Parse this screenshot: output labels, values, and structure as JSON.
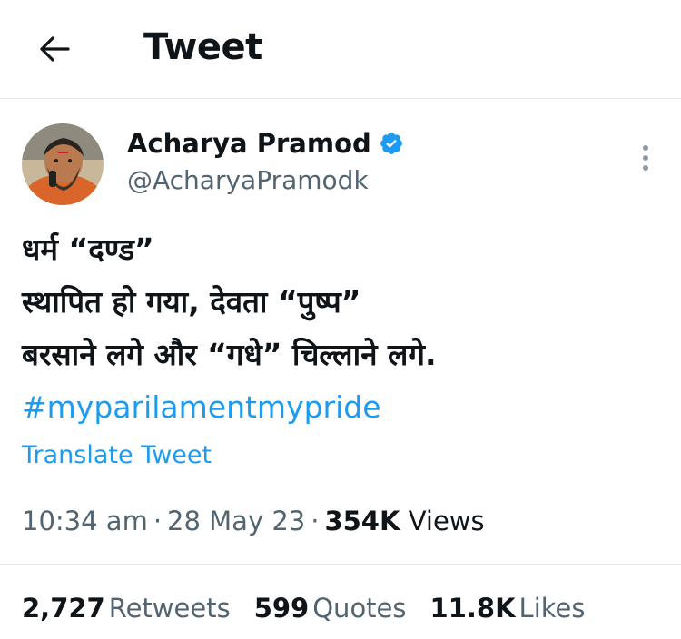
{
  "header": {
    "back_icon": "arrow-left-icon",
    "title": "Tweet"
  },
  "tweet": {
    "author": {
      "display_name": "Acharya Pramod",
      "handle": "@AcharyaPramodk",
      "verified": true,
      "verified_color": "#1d9bf0"
    },
    "text_lines": [
      "धर्म “दण्ड”",
      "स्थापित हो गया, देवता “पुष्प”",
      "बरसाने लगे और “गधे” चिल्लाने लगे."
    ],
    "hashtag": "#myparilamentmypride",
    "translate_label": "Translate Tweet",
    "time": "10:34 am",
    "date": "28 May 23",
    "views_count": "354K",
    "views_label": "Views",
    "stats": [
      {
        "count": "2,727",
        "label": "Retweets"
      },
      {
        "count": "599",
        "label": "Quotes"
      },
      {
        "count": "11.8K",
        "label": "Likes"
      }
    ]
  },
  "colors": {
    "accent": "#1d9bf0",
    "text_primary": "#0f1419",
    "text_secondary": "#536471",
    "divider": "#e6e9ec"
  }
}
